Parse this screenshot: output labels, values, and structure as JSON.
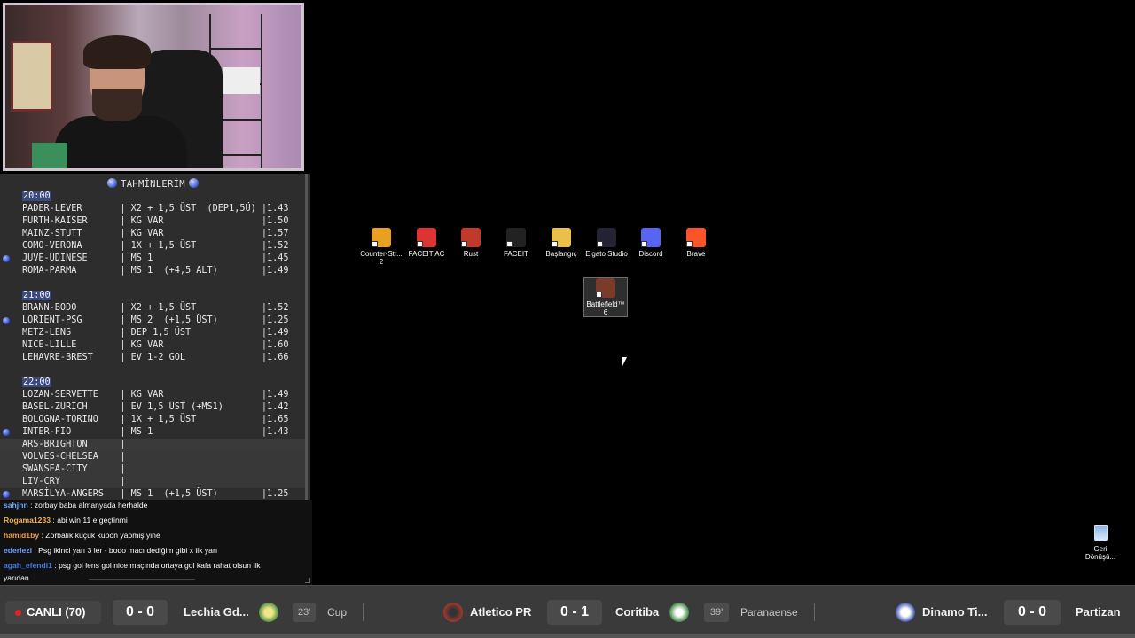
{
  "predictions": {
    "title": "TAHMİNLERİM",
    "lines": [
      {
        "time": "20:00"
      },
      {
        "text": "PADER-LEVER       | X2 + 1,5 ÜST  (DEP1,5Ü) |1.43"
      },
      {
        "text": "FURTH-KAISER      | KG VAR                  |1.50"
      },
      {
        "text": "MAINZ-STUTT       | KG VAR                  |1.57"
      },
      {
        "text": "COMO-VERONA       | 1X + 1,5 ÜST            |1.52"
      },
      {
        "text": "JUVE-UDINESE      | MS 1                    |1.45",
        "dot": true
      },
      {
        "text": "ROMA-PARMA        | MS 1  (+4,5 ALT)        |1.49"
      },
      {
        "text": ""
      },
      {
        "time": "21:00"
      },
      {
        "text": "BRANN-BODO        | X2 + 1,5 ÜST            |1.52"
      },
      {
        "text": "LORIENT-PSG       | MS 2  (+1,5 ÜST)        |1.25",
        "dot": true
      },
      {
        "text": "METZ-LENS         | DEP 1,5 ÜST             |1.49"
      },
      {
        "text": "NICE-LILLE        | KG VAR                  |1.60"
      },
      {
        "text": "LEHAVRE-BREST     | EV 1-2 GOL              |1.66"
      },
      {
        "text": ""
      },
      {
        "time": "22:00"
      },
      {
        "text": "LOZAN-SERVETTE    | KG VAR                  |1.49"
      },
      {
        "text": "BASEL-ZURICH      | EV 1,5 ÜST (+MS1)       |1.42"
      },
      {
        "text": "BOLOGNA-TORINO    | 1X + 1,5 ÜST            |1.65"
      },
      {
        "text": "INTER-FIO         | MS 1                    |1.43",
        "dot": true
      },
      {
        "text": "ARS-BRIGHTON      |",
        "hl": true
      },
      {
        "text": "VOLVES-CHELSEA    |",
        "hl2": true
      },
      {
        "text": "SWANSEA-CITY      |",
        "hl2": true
      },
      {
        "text": "LIV-CRY           |",
        "hl2": true
      },
      {
        "text": "MARSİLYA-ANGERS   | MS 1  (+1,5 ÜST)        |1.25",
        "dot": true
      }
    ]
  },
  "chat": [
    {
      "user": "sahjnn",
      "color": "#6fa8ff",
      "text": " : zorbay baba almanyada herhalde"
    },
    {
      "user": "Rogama1233",
      "color": "#f0b35a",
      "text": " : abi win 11 e geçtinmi"
    },
    {
      "user": "hamid1by",
      "color": "#f0a040",
      "text": " : Zorbalık küçük kupon yapmiş yine"
    },
    {
      "user": "ederlezi",
      "color": "#6f9cff",
      "text": " : Psg ikinci yarı 3 ler - bodo macı dediğim gibi x ilk yarı"
    },
    {
      "user": "agah_efendi1",
      "color": "#3d7ee8",
      "text": " : psg gol lens gol nice maçında ortaya gol kafa rahat olsun ilk"
    },
    {
      "user": "",
      "color": "#fff",
      "text": "yarıdan"
    }
  ],
  "desktop_icons": [
    {
      "label": "Counter-Str... 2",
      "icon": "counter-strike-icon",
      "color": "#e8a020"
    },
    {
      "label": "FACEIT AC",
      "icon": "faceit-ac-icon",
      "color": "#d33"
    },
    {
      "label": "Rust",
      "icon": "rust-icon",
      "color": "#c0392b"
    },
    {
      "label": "FACEIT",
      "icon": "faceit-icon",
      "color": "#222"
    },
    {
      "label": "Başlangıç",
      "icon": "folder-icon",
      "color": "#e8c04a"
    },
    {
      "label": "Elgato Studio",
      "icon": "elgato-icon",
      "color": "#223"
    },
    {
      "label": "Discord",
      "icon": "discord-icon",
      "color": "#5865f2"
    },
    {
      "label": "Brave",
      "icon": "brave-icon",
      "color": "#fb542b"
    },
    {
      "label": "Battlefield™ 6",
      "icon": "battlefield-icon",
      "color": "#7a3b2b"
    }
  ],
  "recycle_bin": {
    "label": "Geri Dönüşü..."
  },
  "ticker": {
    "live_label": "CANLI (70)",
    "matches": [
      {
        "score": "0 - 0",
        "team": "Lechia Gd...",
        "minute": "23'",
        "league": "Cup"
      },
      {
        "home": "Atletico PR",
        "score": "0 - 1",
        "away": "Coritiba",
        "minute": "39'",
        "league": "Paranaense"
      },
      {
        "home": "Dinamo Ti...",
        "score": "0 - 0",
        "away": "Partizan"
      }
    ]
  }
}
